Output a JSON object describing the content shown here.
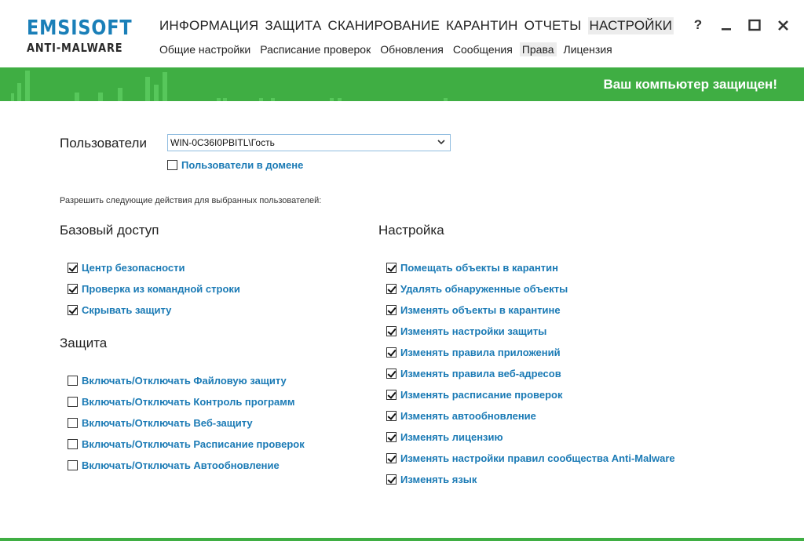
{
  "logo": {
    "line1_a": "EMSI",
    "line1_b": "SOFT",
    "line2": "ANTI-MALWARE"
  },
  "main_nav": [
    "ИНФОРМАЦИЯ",
    "ЗАЩИТА",
    "СКАНИРОВАНИЕ",
    "КАРАНТИН",
    "ОТЧЕТЫ",
    "НАСТРОЙКИ"
  ],
  "main_nav_active": "НАСТРОЙКИ",
  "sub_nav": [
    "Общие настройки",
    "Расписание проверок",
    "Обновления",
    "Сообщения",
    "Права",
    "Лицензия"
  ],
  "sub_nav_active": "Права",
  "window_controls": {
    "help": "?",
    "minimize": "minimize-icon",
    "maximize": "maximize-icon",
    "close": "close-icon"
  },
  "status": {
    "text": "Ваш компьютер защищен!",
    "color": "#3fae43"
  },
  "users": {
    "label": "Пользователи",
    "selected": "WIN-0C36I0PBITL\\Гость",
    "domain_checkbox": {
      "label": "Пользователи в домене",
      "checked": false
    }
  },
  "allow_text": "Разрешить следующие действия для выбранных пользователей:",
  "sections": {
    "basic": {
      "title": "Базовый доступ",
      "items": [
        {
          "label": "Центр безопасности",
          "checked": true
        },
        {
          "label": "Проверка из командной строки",
          "checked": true
        },
        {
          "label": "Скрывать защиту",
          "checked": true
        }
      ]
    },
    "protection": {
      "title": "Защита",
      "items": [
        {
          "label": "Включать/Отключать Файловую защиту",
          "checked": false
        },
        {
          "label": "Включать/Отключать Контроль программ",
          "checked": false
        },
        {
          "label": "Включать/Отключать Веб-защиту",
          "checked": false
        },
        {
          "label": "Включать/Отключать Расписание проверок",
          "checked": false
        },
        {
          "label": "Включать/Отключать Автообновление",
          "checked": false
        }
      ]
    },
    "settings": {
      "title": "Настройка",
      "items": [
        {
          "label": "Помещать объекты в карантин",
          "checked": true
        },
        {
          "label": "Удалять обнаруженные объекты",
          "checked": true
        },
        {
          "label": "Изменять объекты в карантине",
          "checked": true
        },
        {
          "label": "Изменять настройки защиты",
          "checked": true
        },
        {
          "label": "Изменять правила приложений",
          "checked": true
        },
        {
          "label": "Изменять правила веб-адресов",
          "checked": true
        },
        {
          "label": "Изменять расписание проверок",
          "checked": true
        },
        {
          "label": "Изменять автообновление",
          "checked": true
        },
        {
          "label": "Изменять лицензию",
          "checked": true
        },
        {
          "label": "Изменять настройки правил сообщества Anti-Malware",
          "checked": true
        },
        {
          "label": "Изменять язык",
          "checked": true
        }
      ]
    }
  }
}
